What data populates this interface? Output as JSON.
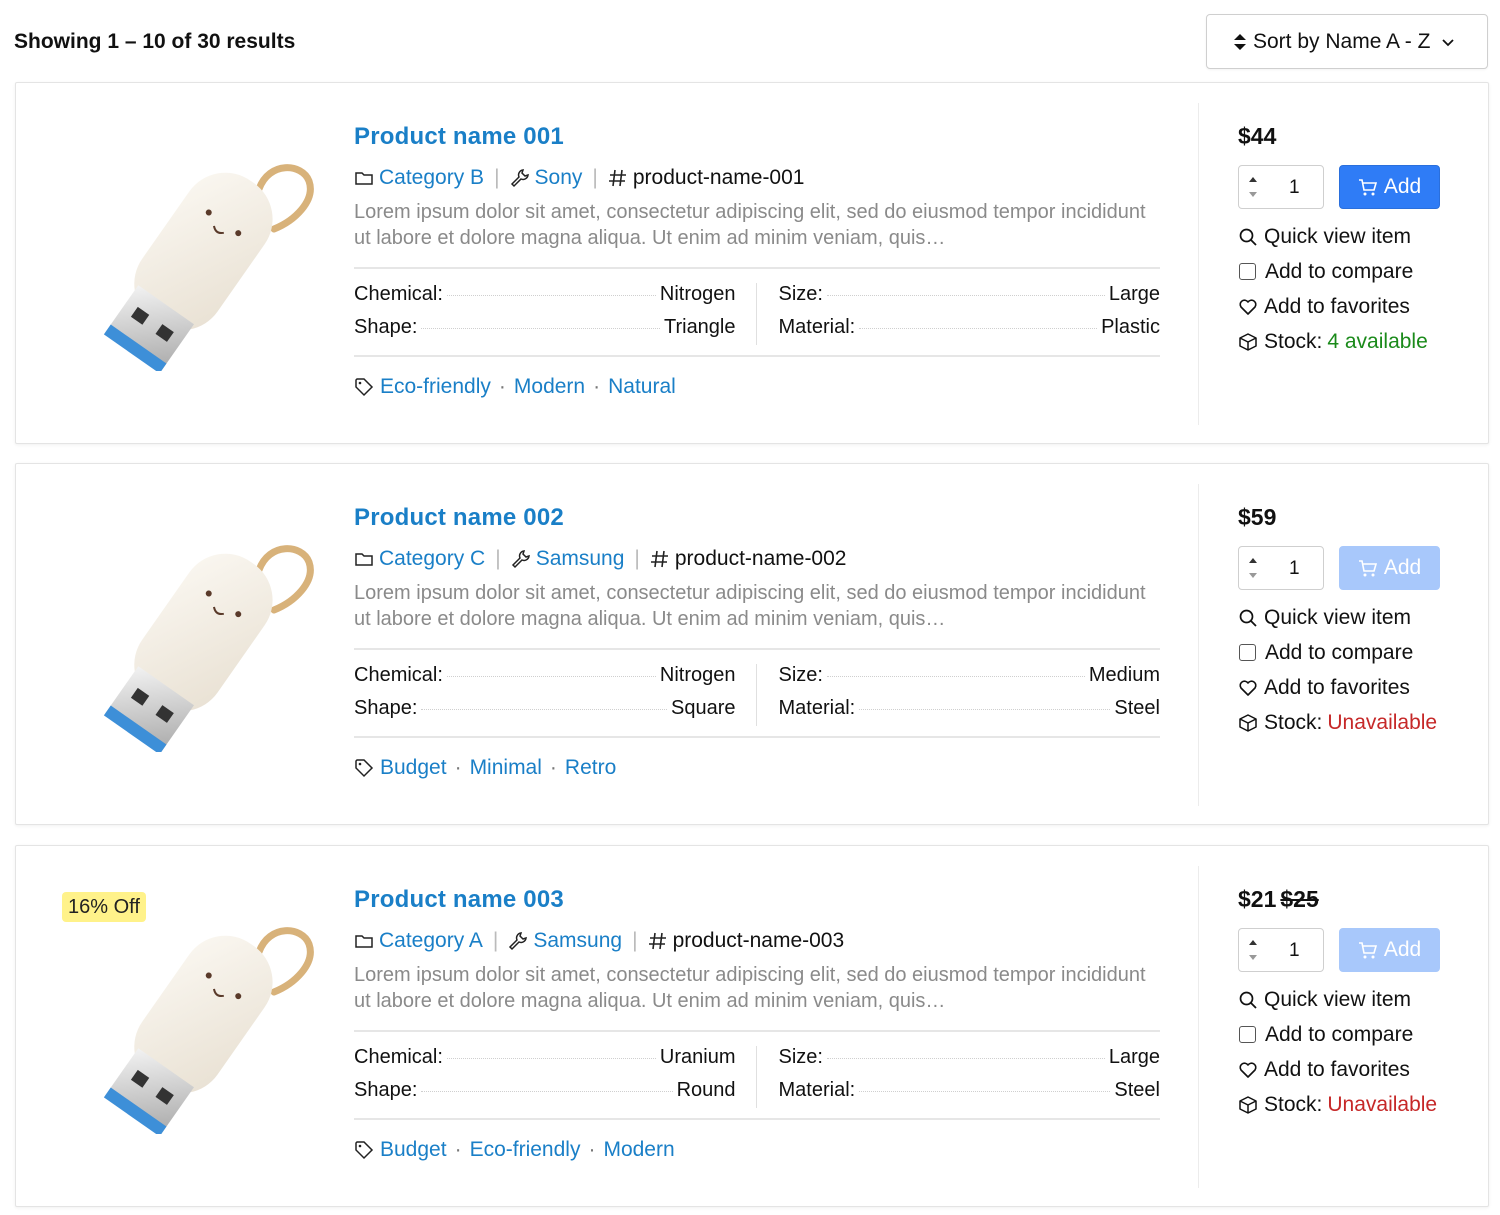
{
  "header": {
    "results_text": "Showing 1 – 10 of 30 results",
    "sort_label": "Sort by Name A - Z"
  },
  "colors": {
    "link": "#1a7fc7",
    "add_button": "#2f7cf6",
    "add_button_disabled": "#a8c8fb",
    "stock_available": "#1a8a1a",
    "stock_unavailable": "#c62828",
    "badge": "#fff28a"
  },
  "labels": {
    "chemical": "Chemical:",
    "shape": "Shape:",
    "size": "Size:",
    "material": "Material:",
    "add": "Add",
    "quick_view": "Quick view item",
    "compare": "Add to compare",
    "favorites": "Add to favorites",
    "stock": "Stock:"
  },
  "icons": {
    "sort": "sort-icon",
    "chevron": "chevron-down-icon",
    "category": "folder-icon",
    "brand": "wrench-icon",
    "sku": "hash-icon",
    "tags": "tag-icon",
    "cart": "cart-icon",
    "quick_view": "search-icon",
    "favorites": "heart-icon",
    "stock": "box-icon"
  },
  "products": [
    {
      "name": "Product name 001",
      "category": "Category B",
      "brand": "Sony",
      "sku": "product-name-001",
      "description": "Lorem ipsum dolor sit amet, consectetur adipiscing elit, sed do eiusmod tempor incididunt ut labore et dolore magna aliqua. Ut enim ad minim veniam, quis…",
      "chemical": "Nitrogen",
      "shape": "Triangle",
      "size": "Large",
      "material": "Plastic",
      "tags": [
        "Eco-friendly",
        "Modern",
        "Natural"
      ],
      "price": "$44",
      "old_price": "",
      "badge": "",
      "quantity": "1",
      "add_enabled": true,
      "stock": "4 available",
      "in_stock": true
    },
    {
      "name": "Product name 002",
      "category": "Category C",
      "brand": "Samsung",
      "sku": "product-name-002",
      "description": "Lorem ipsum dolor sit amet, consectetur adipiscing elit, sed do eiusmod tempor incididunt ut labore et dolore magna aliqua. Ut enim ad minim veniam, quis…",
      "chemical": "Nitrogen",
      "shape": "Square",
      "size": "Medium",
      "material": "Steel",
      "tags": [
        "Budget",
        "Minimal",
        "Retro"
      ],
      "price": "$59",
      "old_price": "",
      "badge": "",
      "quantity": "1",
      "add_enabled": false,
      "stock": "Unavailable",
      "in_stock": false
    },
    {
      "name": "Product name 003",
      "category": "Category A",
      "brand": "Samsung",
      "sku": "product-name-003",
      "description": "Lorem ipsum dolor sit amet, consectetur adipiscing elit, sed do eiusmod tempor incididunt ut labore et dolore magna aliqua. Ut enim ad minim veniam, quis…",
      "chemical": "Uranium",
      "shape": "Round",
      "size": "Large",
      "material": "Steel",
      "tags": [
        "Budget",
        "Eco-friendly",
        "Modern"
      ],
      "price": "$21",
      "old_price": "$25",
      "badge": "16% Off",
      "quantity": "1",
      "add_enabled": false,
      "stock": "Unavailable",
      "in_stock": false
    }
  ]
}
